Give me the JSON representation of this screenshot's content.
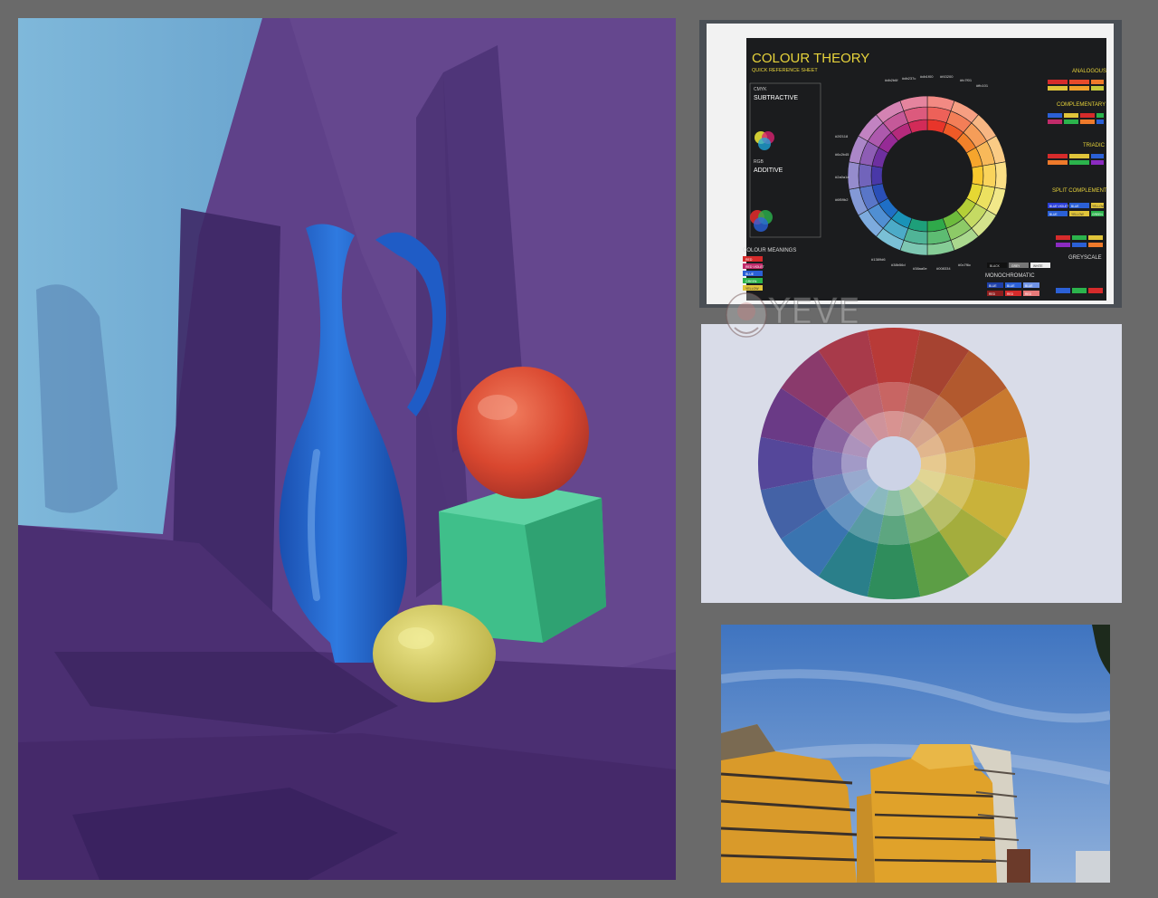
{
  "painting": {
    "colors": {
      "background_left": "#7cb6d8",
      "drape": "#5c3f86",
      "jug": "#1f6ad6",
      "ball": "#e1543a",
      "cube": "#3fbf8a",
      "lemon": "#d6cf5a"
    }
  },
  "sheet": {
    "title": "COLOUR THEORY",
    "subtitle": "QUICK REFERENCE SHEET",
    "cmyk_label": "CMYK",
    "subtractive_label": "SUBTRACTIVE",
    "rgb_label": "RGB",
    "additive_label": "ADDITIVE",
    "meanings_label": "COLOUR MEANINGS",
    "analogous_label": "ANALOGOUS",
    "complementary_label": "COMPLEMENTARY",
    "triadic_label": "TRIADIC",
    "split_label": "SPLIT COMPLEMENT",
    "greyscale_label": "GREYSCALE",
    "monochromatic_label": "MONOCHROMATIC",
    "hex_top": [
      "#db2b6f",
      "#db237c",
      "#db1f00",
      "#f43200",
      "#fc7f01",
      "#ffc101"
    ],
    "hex_side": [
      "#2f2118",
      "#6c2b45",
      "#2a0a1e",
      "#6f59b2"
    ],
    "hex_bottom": [
      "#1389d6",
      "#38b56d",
      "#38aa0e",
      "#008334",
      "#0c7f6c"
    ],
    "meaning_tags": [
      "RED",
      "RED VIOLET",
      "BLUE",
      "GREEN",
      "YELLOW"
    ],
    "split_tags": [
      "BLUE VIOLET",
      "BLUE",
      "YELLOW",
      "BLUE",
      "YELLOW",
      "GREEN"
    ],
    "grey_tags": [
      "BLACK",
      "GREY",
      "WHITE"
    ],
    "mono_tags": [
      "BLUE",
      "BLUE",
      "BLUE",
      "RED",
      "RED",
      "RED"
    ]
  },
  "wheel_photo": {
    "colors": [
      "#b83a37",
      "#a64331",
      "#b2592e",
      "#c97a2f",
      "#d39c33",
      "#c9b23a",
      "#a4ad3d",
      "#5c9e45",
      "#2f8d5c",
      "#2a7f8a",
      "#3a74b0",
      "#4462a6",
      "#55479a",
      "#6a3a86",
      "#8a3a6c",
      "#a83a4a"
    ]
  },
  "watermark": {
    "text": "YEVE"
  },
  "building_photo": {
    "colors": {
      "sky": "#4a7fc6",
      "facade": "#e0a22a",
      "shadow": "#3b3129"
    }
  }
}
